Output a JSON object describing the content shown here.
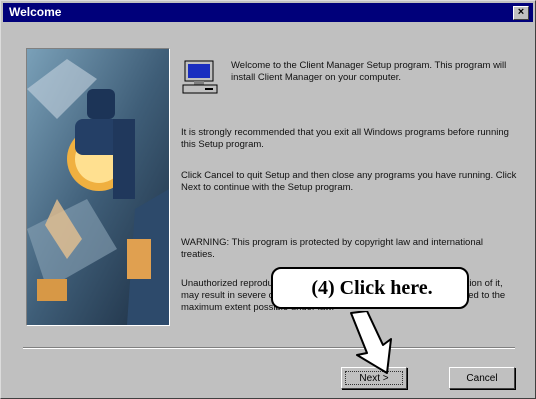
{
  "window": {
    "title": "Welcome"
  },
  "content": {
    "intro": "Welcome to the Client Manager Setup program. This program will install Client Manager on your computer.",
    "exit_note": "It is strongly recommended that you exit all Windows programs before running this Setup program.",
    "cancel_note": "Click Cancel to quit Setup and then close any programs you have running. Click Next to continue with the Setup program.",
    "warning": "WARNING: This program is protected by copyright law and international treaties.",
    "unauthorized": "Unauthorized reproduction or distribution of this program, or any portion of it, may result in severe civil and criminal penalties, and will be prosecuted to the maximum extent possible under law."
  },
  "buttons": {
    "next": "Next >",
    "cancel": "Cancel"
  },
  "callout": {
    "label": "(4)  Click here."
  },
  "icons": {
    "close": "close-icon",
    "setup": "computer-icon",
    "pointer": "arrow-icon"
  }
}
